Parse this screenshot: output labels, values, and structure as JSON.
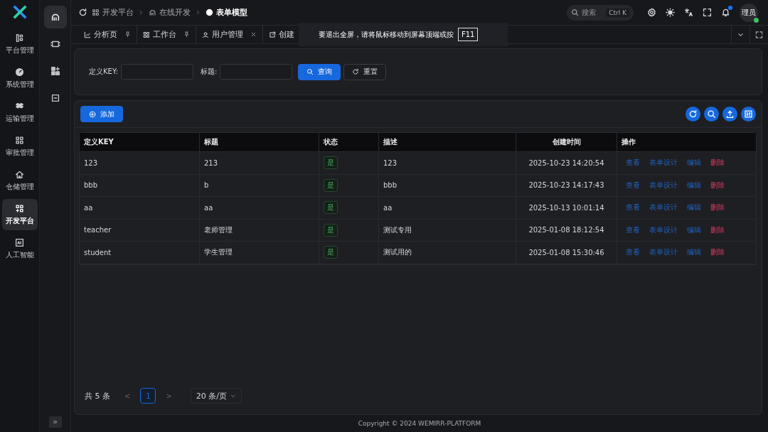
{
  "sidebar": {
    "items": [
      {
        "label": "平台管理",
        "selected": false
      },
      {
        "label": "系统管理",
        "selected": false
      },
      {
        "label": "运输管理",
        "selected": false
      },
      {
        "label": "审批管理",
        "selected": false
      },
      {
        "label": "仓储管理",
        "selected": false
      },
      {
        "label": "开发平台",
        "selected": true
      },
      {
        "label": "人工智能",
        "selected": false
      }
    ]
  },
  "subrail": {
    "items": [
      {
        "selected": true
      },
      {
        "selected": false
      },
      {
        "selected": false
      },
      {
        "selected": false
      }
    ],
    "expand": "»"
  },
  "breadcrumb": [
    {
      "label": "开发平台",
      "current": false
    },
    {
      "label": "在线开发",
      "current": false
    },
    {
      "label": "表单模型",
      "current": true
    }
  ],
  "header": {
    "search": {
      "placeholder": "搜索",
      "shortcut": "Ctrl K"
    },
    "notification_dot": true,
    "avatar": {
      "label": "理员",
      "online": true
    }
  },
  "tabs": [
    {
      "label": "分析页",
      "kind": "pinned"
    },
    {
      "label": "工作台",
      "kind": "pinned"
    },
    {
      "label": "用户管理",
      "kind": "closable"
    },
    {
      "label": "创建",
      "kind": "plain"
    }
  ],
  "fullscreen_notice": {
    "text": "要退出全屏，请将鼠标移动到屏幕顶端或按",
    "key": "F11"
  },
  "filters": {
    "fields": [
      {
        "label": "定义KEY:"
      },
      {
        "label": "标题:"
      }
    ],
    "search_button": "查询",
    "reset_button": "重置"
  },
  "toolbar": {
    "add_button": "添加"
  },
  "table": {
    "columns": [
      "定义KEY",
      "标题",
      "状态",
      "描述",
      "创建时间",
      "操作"
    ],
    "rows": [
      {
        "cells": [
          "123",
          "213",
          "是",
          "123",
          "2025-10-23 14:20:54"
        ],
        "actions": [
          {
            "label": "查看",
            "kind": "link"
          },
          {
            "label": "表单设计",
            "kind": "link"
          },
          {
            "label": "编辑",
            "kind": "link"
          },
          {
            "label": "删除",
            "kind": "danger"
          }
        ]
      },
      {
        "cells": [
          "bbb",
          "b",
          "是",
          "bbb",
          "2025-10-23 14:17:43"
        ],
        "actions": [
          {
            "label": "查看",
            "kind": "link"
          },
          {
            "label": "表单设计",
            "kind": "link"
          },
          {
            "label": "编辑",
            "kind": "link"
          },
          {
            "label": "删除",
            "kind": "danger"
          }
        ]
      },
      {
        "cells": [
          "aa",
          "aa",
          "是",
          "aa",
          "2025-10-13 10:01:14"
        ],
        "actions": [
          {
            "label": "查看",
            "kind": "link"
          },
          {
            "label": "表单设计",
            "kind": "link"
          },
          {
            "label": "编辑",
            "kind": "link"
          },
          {
            "label": "删除",
            "kind": "danger"
          }
        ]
      },
      {
        "cells": [
          "teacher",
          "老师管理",
          "是",
          "测试专用",
          "2025-01-08 18:12:54"
        ],
        "actions": [
          {
            "label": "查看",
            "kind": "link"
          },
          {
            "label": "表单设计",
            "kind": "link"
          },
          {
            "label": "编辑",
            "kind": "link"
          },
          {
            "label": "删除",
            "kind": "danger"
          }
        ]
      },
      {
        "cells": [
          "student",
          "学生管理",
          "是",
          "测试用的",
          "2025-01-08 15:30:46"
        ],
        "actions": [
          {
            "label": "查看",
            "kind": "link"
          },
          {
            "label": "表单设计",
            "kind": "link"
          },
          {
            "label": "编辑",
            "kind": "link"
          },
          {
            "label": "删除",
            "kind": "danger"
          }
        ]
      }
    ]
  },
  "pagination": {
    "total": "共 5 条",
    "prev": "<",
    "pages": [
      {
        "label": "1",
        "selected": true
      }
    ],
    "next": ">",
    "page_size": "20 条/页"
  },
  "footer": "Copyright © 2024 WEMIRR-PLATFORM"
}
